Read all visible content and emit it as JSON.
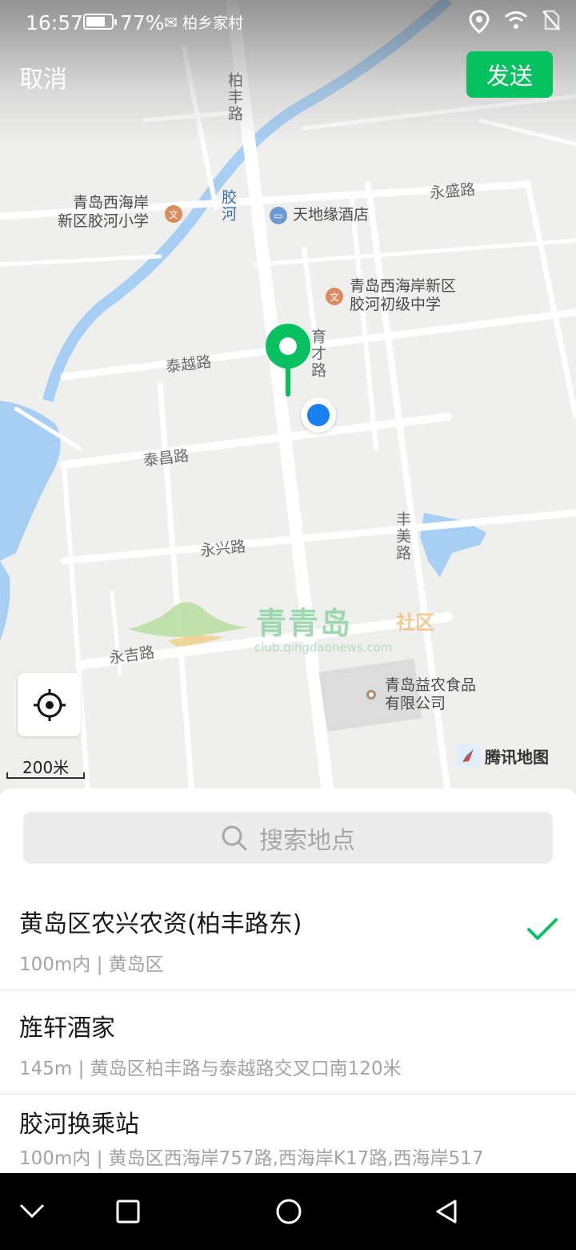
{
  "status_bar": {
    "time": "16:57",
    "battery_level": 0.77,
    "battery_percent": "77%",
    "overlay_text": "柏乡家村"
  },
  "header": {
    "cancel_label": "取消",
    "send_label": "发送",
    "accent_color": "#07c160"
  },
  "map": {
    "roads": {
      "baifeng_lu": "柏丰路",
      "jiaohe_river": "胶河",
      "yongsheng_lu": "永盛路",
      "taiyue_lu": "泰越路",
      "yucai_lu": "育才路",
      "taichang_lu": "泰昌路",
      "yongxing_lu": "永兴路",
      "fengmei_lu": "丰美路",
      "yongji_lu": "永吉路"
    },
    "pois": {
      "primary_school": "青岛西海岸\n新区胶河小学",
      "hotel": "天地缘酒店",
      "middle_school": "青岛西海岸新区\n胶河初级中学",
      "food_company": "青岛益农食品\n有限公司"
    },
    "scale_label": "200米",
    "brand_label": "腾讯地图",
    "watermark": {
      "title": "青青岛",
      "tag": "社区",
      "url": "club.qingdaonews.com"
    }
  },
  "search": {
    "placeholder": "搜索地点"
  },
  "results": [
    {
      "title": "黄岛区农兴农资(柏丰路东)",
      "subtitle": "100m内 | 黄岛区",
      "selected": true
    },
    {
      "title": "旌轩酒家",
      "subtitle": "145m | 黄岛区柏丰路与泰越路交叉口南120米",
      "selected": false
    },
    {
      "title": "胶河换乘站",
      "subtitle": "100m内 | 黄岛区西海岸757路,西海岸K17路,西海岸517",
      "selected": false
    }
  ],
  "icons": {
    "locate": "crosshair-icon",
    "search": "search-icon",
    "check": "check-icon",
    "nav_back": "triangle-back-icon",
    "nav_home": "circle-home-icon",
    "nav_recents": "square-recents-icon",
    "nav_hide": "chevron-down-icon"
  }
}
